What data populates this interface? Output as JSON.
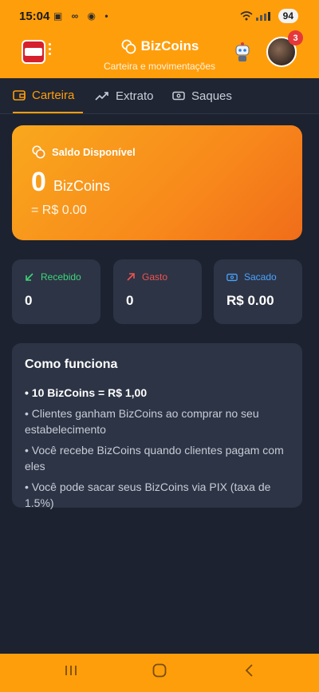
{
  "status_bar": {
    "time": "15:04",
    "left_icons": "▣ ∞ ◉ •",
    "battery": "94"
  },
  "header": {
    "title": "BizCoins",
    "subtitle": "Carteira e movimentações",
    "notification_count": "3",
    "icons": [
      "logo-icon",
      "coins-icon",
      "robot-icon",
      "avatar"
    ]
  },
  "tabs": [
    {
      "label": "Carteira",
      "icon": "wallet-icon",
      "active": true
    },
    {
      "label": "Extrato",
      "icon": "trend-icon",
      "active": false
    },
    {
      "label": "Saques",
      "icon": "cash-icon",
      "active": false
    }
  ],
  "saldo": {
    "label": "Saldo Disponível",
    "value": "0",
    "unit": "BizCoins",
    "brl": "= R$ 0.00"
  },
  "stats": [
    {
      "label": "Recebido",
      "value": "0",
      "color": "#3fd57a",
      "icon": "arrow-down-left-icon"
    },
    {
      "label": "Gasto",
      "value": "0",
      "color": "#ef5350",
      "icon": "arrow-up-right-icon"
    },
    {
      "label": "Sacado",
      "value": "R$ 0.00",
      "color": "#4aa3ff",
      "icon": "cash-icon"
    }
  ],
  "how": {
    "title": "Como funciona",
    "items": [
      "• 10 BizCoins = R$ 1,00",
      "• Clientes ganham BizCoins ao comprar no seu estabelecimento",
      "• Você recebe BizCoins quando clientes pagam com eles",
      "• Você pode sacar seus BizCoins via PIX (taxa de 1.5%)"
    ]
  },
  "colors": {
    "accent": "#ff9e0b",
    "background": "#1c2230",
    "card": "#2d3445"
  }
}
